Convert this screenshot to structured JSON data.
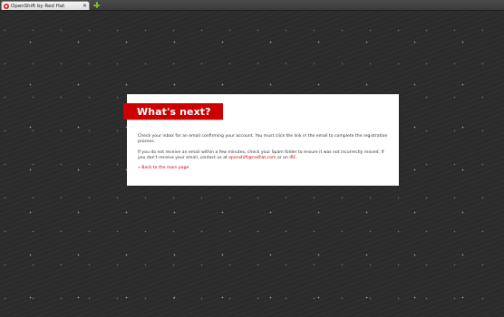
{
  "browser": {
    "tab_title": "OpenShift by Red Hat",
    "tab_close": "✕",
    "new_tab_icon": "plus-icon"
  },
  "card": {
    "heading": "What's next?",
    "paragraph1": "Check your inbox for an email confirming your account. You must click the link in the email to complete the registration process.",
    "paragraph2_prefix": "If you do not receive an email within a few minutes, check your Spam folder to ensure it was not incorrectly moved. If you don't receive your email, contact us at ",
    "email_link": "openshift@redhat.com",
    "paragraph2_middle": " or on ",
    "irc_link": "IRC",
    "paragraph2_suffix": ".",
    "back_link": "» Back to the main page"
  },
  "colors": {
    "accent": "#cc0000",
    "background": "#2c2c2c",
    "card": "#ffffff"
  }
}
